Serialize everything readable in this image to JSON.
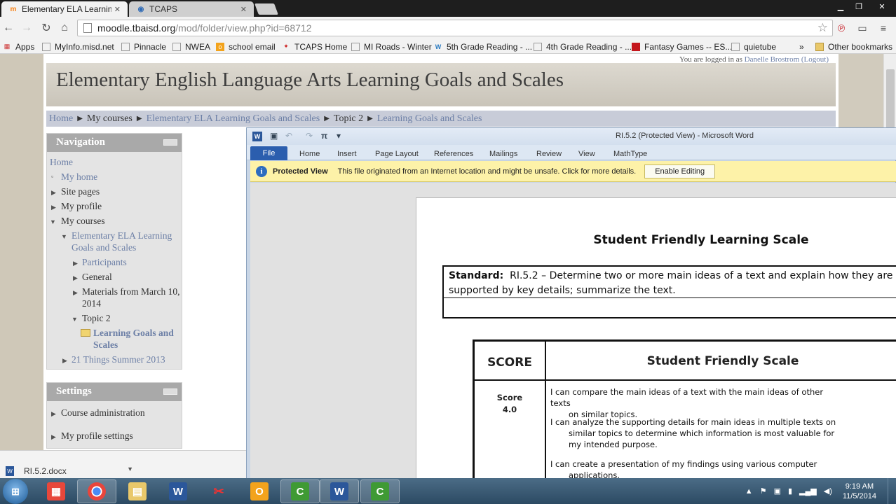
{
  "browser": {
    "tabs": [
      {
        "title": "Elementary ELA Learning G",
        "favicon": "moodle-icon",
        "active": true
      },
      {
        "title": "TCAPS",
        "favicon": "globe-icon",
        "active": false
      }
    ],
    "url_host": "moodle.tbaisd.org",
    "url_path": "/mod/folder/view.php?id=68712",
    "bookmarks": [
      {
        "label": "Apps",
        "icon": "apps-grid-icon"
      },
      {
        "label": "MyInfo.misd.net",
        "icon": "page-icon"
      },
      {
        "label": "Pinnacle",
        "icon": "page-icon"
      },
      {
        "label": "NWEA",
        "icon": "page-icon"
      },
      {
        "label": "school email",
        "icon": "outlook-icon"
      },
      {
        "label": "TCAPS Home",
        "icon": "tcaps-icon"
      },
      {
        "label": "MI Roads - Winter",
        "icon": "page-icon"
      },
      {
        "label": "5th Grade Reading - ...",
        "icon": "wordpress-icon"
      },
      {
        "label": "4th Grade Reading - ...",
        "icon": "page-icon"
      },
      {
        "label": "Fantasy Games -- ES...",
        "icon": "fantasy-icon"
      },
      {
        "label": "quietube",
        "icon": "page-icon"
      }
    ],
    "bookmarks_more": "»",
    "other_bookmarks": "Other bookmarks"
  },
  "moodle": {
    "logged_in_prefix": "You are logged in as",
    "user_name": "Danelle Brostrom",
    "logout": "(Logout)",
    "site_title": "Elementary English Language Arts Learning Goals and Scales",
    "breadcrumb": [
      "Home",
      "My courses",
      "Elementary ELA Learning Goals and Scales",
      "Topic 2",
      "Learning Goals and Scales"
    ],
    "navigation": {
      "title": "Navigation",
      "home": "Home",
      "my_home": "My home",
      "site_pages": "Site pages",
      "my_profile": "My profile",
      "my_courses": "My courses",
      "course_name": "Elementary ELA Learning Goals and Scales",
      "participants": "Participants",
      "general": "General",
      "materials": "Materials from March 10, 2014",
      "topic2": "Topic 2",
      "current_folder": "Learning Goals and Scales",
      "other_course": "21 Things Summer 2013"
    },
    "settings": {
      "title": "Settings",
      "course_admin": "Course administration",
      "profile_settings": "My profile settings"
    }
  },
  "word": {
    "window_title": "RI.5.2 (Protected View)  -  Microsoft Word",
    "ribbon_tabs": [
      "File",
      "Home",
      "Insert",
      "Page Layout",
      "References",
      "Mailings",
      "Review",
      "View",
      "MathType"
    ],
    "protected_label": "Protected View",
    "protected_message": "This file originated from an Internet location and might be unsafe. Click for more details.",
    "enable_editing": "Enable Editing",
    "document": {
      "heading": "Student Friendly Learning Scale",
      "standard_label": "Standard:",
      "standard_text": "RI.5.2 –  Determine two or more main ideas of a text and explain how they are supported by key details; summarize the text.",
      "col_score": "SCORE",
      "col_scale": "Student Friendly Scale",
      "score_label": "Score",
      "score_value": "4.0",
      "line1a": "I can compare the main ideas of a text with the main ideas of other texts",
      "line1b": "on similar topics.",
      "line2a": "I can analyze the supporting details for main ideas in multiple texts on",
      "line2b": "similar topics to determine which information is most valuable for my intended purpose.",
      "line3a": "I can create a presentation of my findings using various computer",
      "line3b": "applications."
    }
  },
  "download": {
    "file": "RI.5.2.docx"
  },
  "taskbar": {
    "time": "9:19 AM",
    "date": "11/5/2014"
  }
}
